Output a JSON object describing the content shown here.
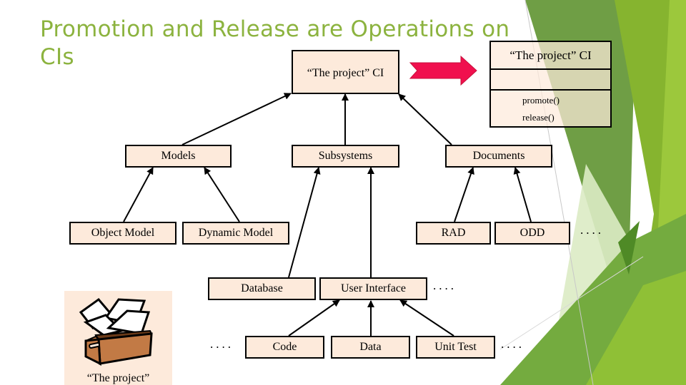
{
  "slide": {
    "title": "Promotion and Release are Operations on CIs",
    "colors": {
      "title": "#8cb33f",
      "box_fill": "#fdeadb",
      "arrow": "#f0104e",
      "green_dark": "#5f9234",
      "green_mid": "#85b52c",
      "green_light": "#9cc83c"
    }
  },
  "diagram": {
    "root": {
      "label": "“The project” CI"
    },
    "promotion_arrow": {
      "icon": "right-arrow-icon"
    },
    "uml_class": {
      "name": "“The project” CI",
      "attributes": [],
      "operations": [
        "promote()",
        "release()"
      ]
    },
    "level1": [
      {
        "label": "Models"
      },
      {
        "label": "Subsystems"
      },
      {
        "label": "Documents"
      }
    ],
    "level2": [
      {
        "label": "Object Model"
      },
      {
        "label": "Dynamic Model"
      },
      {
        "label": "RAD"
      },
      {
        "label": "ODD"
      }
    ],
    "level3": [
      {
        "label": "Database"
      },
      {
        "label": "User Interface"
      }
    ],
    "level4": [
      {
        "label": "Code"
      },
      {
        "label": "Data"
      },
      {
        "label": "Unit Test"
      }
    ],
    "ellipses": {
      "documents_more": "....",
      "ui_more": "....",
      "left_more": "....",
      "right_more": "...."
    },
    "picture": {
      "icon": "open-box-icon",
      "caption": "“The project”"
    }
  }
}
